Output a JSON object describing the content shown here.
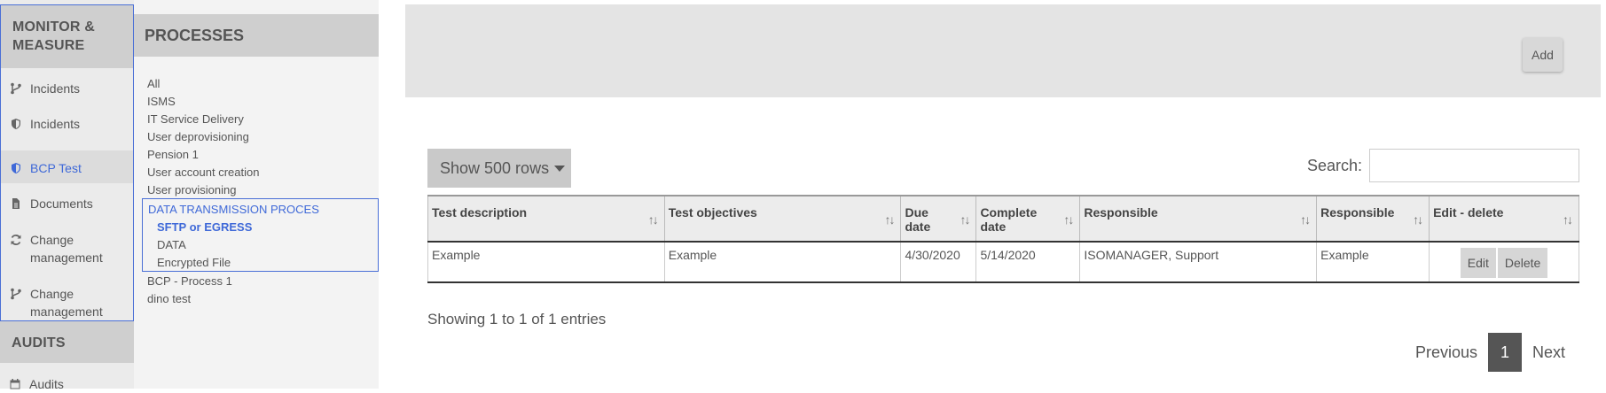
{
  "leftnav": {
    "monitor_header": "MONITOR & MEASURE",
    "items": [
      {
        "label": "Incidents",
        "icon": "branch-icon"
      },
      {
        "label": "Incidents",
        "icon": "shield-icon"
      },
      {
        "label": "BCP Test",
        "icon": "shield-icon"
      },
      {
        "label": "Documents",
        "icon": "document-icon"
      },
      {
        "label": "Change management",
        "icon": "refresh-icon"
      },
      {
        "label": "Change management",
        "icon": "branch-icon"
      }
    ],
    "audits_header": "AUDITS",
    "audits_item": {
      "label": "Audits",
      "icon": "calendar-icon"
    }
  },
  "processes": {
    "header": "PROCESSES",
    "items": [
      "All",
      "ISMS",
      "IT Service Delivery",
      "User deprovisioning",
      "Pension 1",
      "User account creation",
      "User provisioning"
    ],
    "selected": "DATA TRANSMISSION PROCES",
    "sub_items": [
      "SFTP or EGRESS",
      "DATA",
      "Encrypted File"
    ],
    "after": [
      "BCP - Process 1",
      "dino test"
    ]
  },
  "main": {
    "add_label": "Add",
    "show_rows_label": "Show 500 rows",
    "search_label": "Search:",
    "search_value": "",
    "columns": [
      "Test description",
      "Test objectives",
      "Due date",
      "Complete date",
      "Responsible",
      "Responsible",
      "Edit - delete"
    ],
    "rows": [
      {
        "test_description": "Example",
        "test_objectives": "Example",
        "due_date": "4/30/2020",
        "complete_date": "5/14/2020",
        "responsible1": "ISOMANAGER, Support",
        "responsible2": "Example",
        "edit_label": "Edit",
        "delete_label": "Delete"
      }
    ],
    "showing_text": "Showing 1 to 1 of 1 entries",
    "pagination": {
      "previous": "Previous",
      "current": "1",
      "next": "Next"
    }
  },
  "colors": {
    "accent": "#3f69d8",
    "nav_bg": "#ebebeb",
    "header_bg": "#cfcfcf"
  }
}
